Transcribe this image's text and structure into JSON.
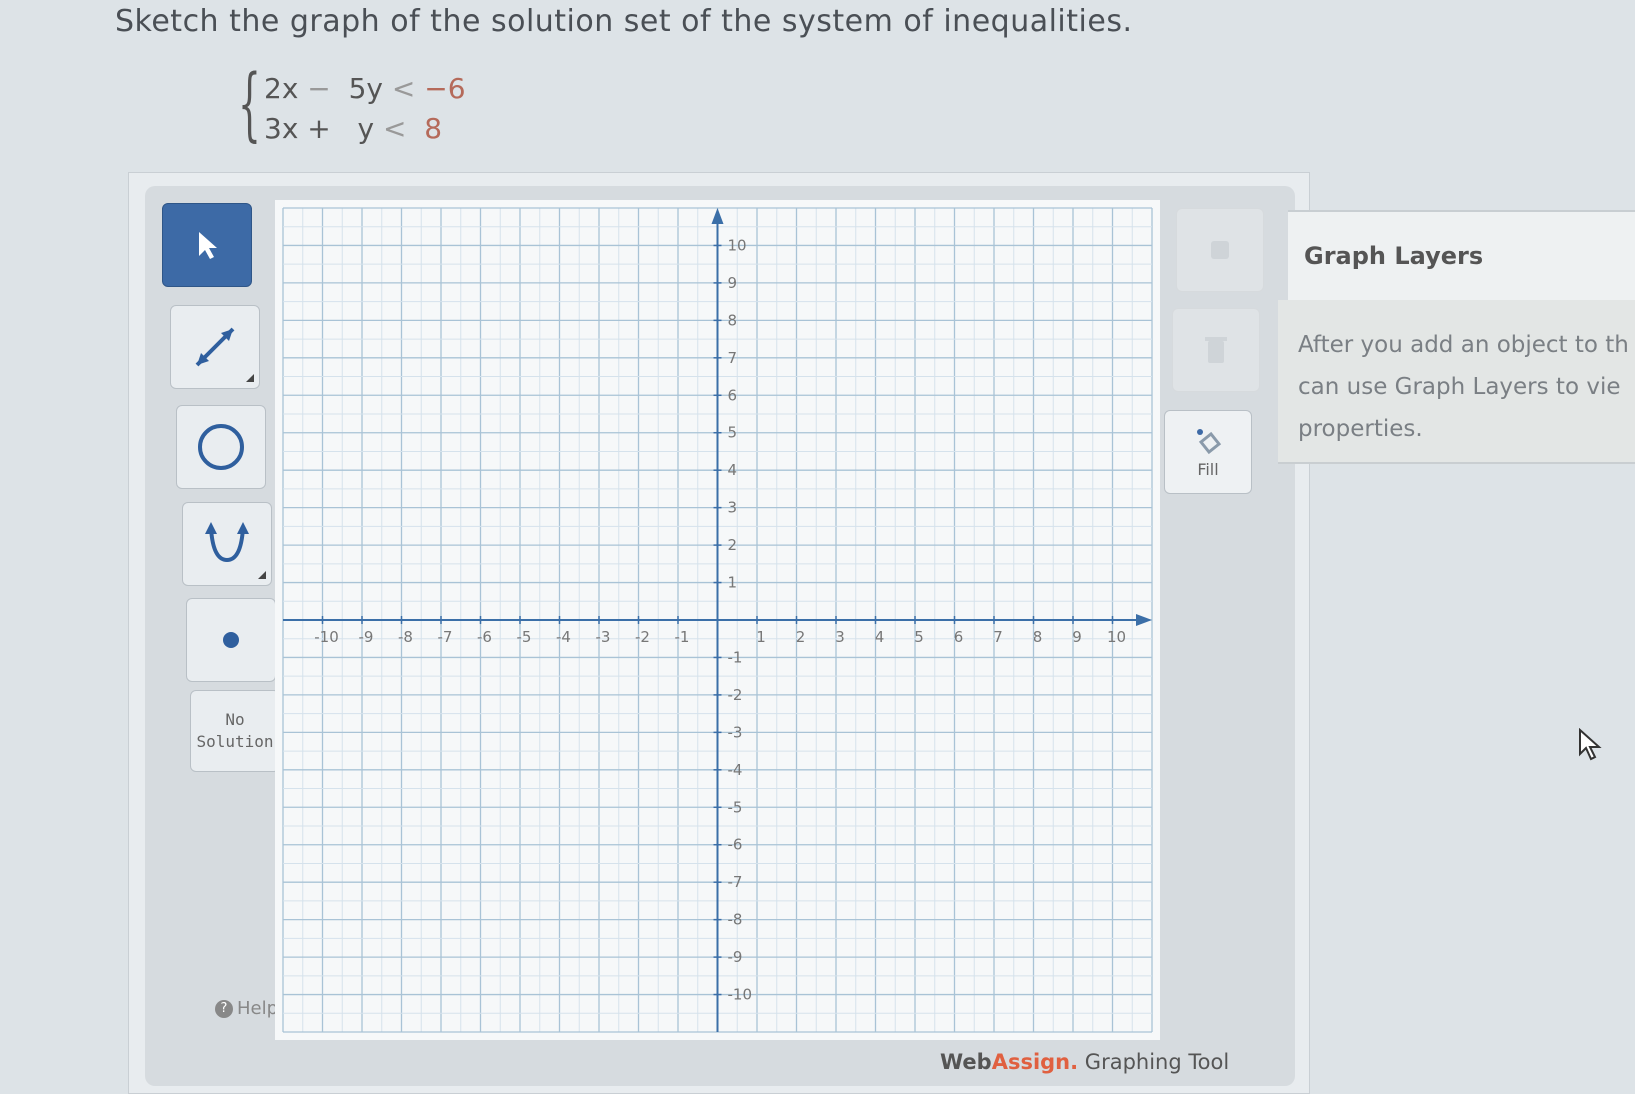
{
  "question": "Sketch the graph of the solution set of the system of inequalities.",
  "system": {
    "ineq1": {
      "lhs1": "2x",
      "op": "−",
      "lhs2": "5y",
      "rel": "<",
      "rhs": "−6"
    },
    "ineq2": {
      "lhs1": "3x",
      "op": "+",
      "lhs2": "y",
      "rel": "<",
      "rhs": "8"
    }
  },
  "toolbar": {
    "tools": [
      {
        "name": "pointer",
        "icon": "arrow-cursor-icon",
        "active": true
      },
      {
        "name": "line",
        "icon": "line-tool-icon"
      },
      {
        "name": "circle",
        "icon": "circle-tool-icon"
      },
      {
        "name": "parabola",
        "icon": "parabola-tool-icon"
      },
      {
        "name": "point",
        "icon": "point-tool-icon"
      }
    ],
    "no_solution_line1": "No",
    "no_solution_line2": "Solution",
    "help_label": "Help"
  },
  "graph": {
    "x_ticks": [
      "-10",
      "-9",
      "-8",
      "-7",
      "-6",
      "-5",
      "-4",
      "-3",
      "-2",
      "-1",
      "1",
      "2",
      "3",
      "4",
      "5",
      "6",
      "7",
      "8",
      "9",
      "10"
    ],
    "y_ticks": [
      "10",
      "9",
      "8",
      "7",
      "6",
      "5",
      "4",
      "3",
      "2",
      "1",
      "-1",
      "-2",
      "-3",
      "-4",
      "-5",
      "-6",
      "-7",
      "-8",
      "-9",
      "-10"
    ],
    "xlim": [
      -11,
      11
    ],
    "ylim": [
      -11,
      11
    ],
    "grid": true
  },
  "side_buttons": {
    "fill_label": "Fill"
  },
  "brand": {
    "web": "Web",
    "assign": "Assign.",
    "rest": " Graphing Tool"
  },
  "layers": {
    "title": "Graph Layers",
    "text": "After you add an object to th\ncan use Graph Layers to vie\nproperties."
  }
}
